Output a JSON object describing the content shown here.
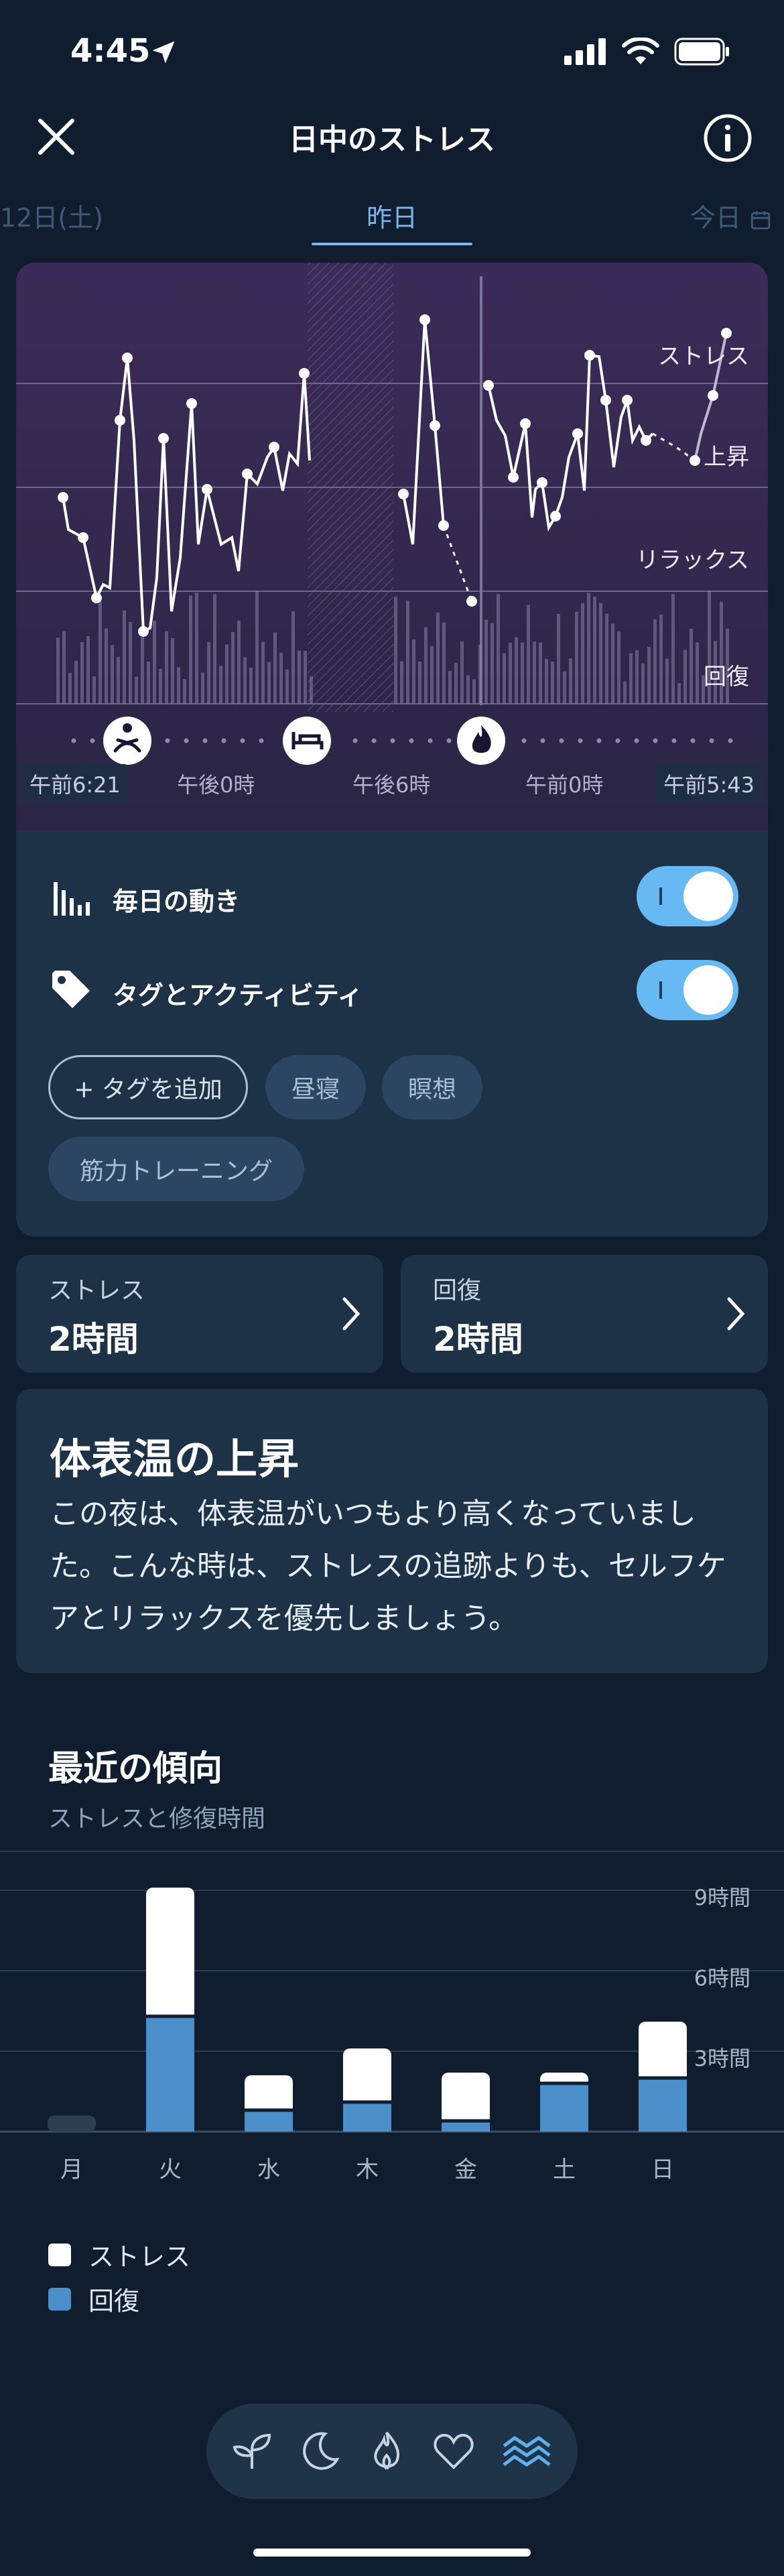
{
  "status": {
    "time": "4:45"
  },
  "header": {
    "title": "日中のストレス"
  },
  "date_tabs": {
    "prev": "12日(土)",
    "current": "昨日",
    "next": "今日"
  },
  "chart": {
    "zone_labels": [
      "ストレス",
      "上昇",
      "リラックス",
      "回復"
    ],
    "time_labels": [
      "午前6:21",
      "午後0時",
      "午後6時",
      "午前0時",
      "午前5:43"
    ],
    "event_icons": [
      "meditation-icon",
      "bed-icon",
      "flame-icon"
    ]
  },
  "controls": {
    "daily_movement_label": "毎日の動き",
    "daily_movement_on": true,
    "tags_label": "タグとアクティビティ",
    "tags_on": true,
    "add_tag_label": "+ タグを追加",
    "tags": [
      "昼寝",
      "瞑想",
      "筋力トレーニング"
    ]
  },
  "summary": [
    {
      "label": "ストレス",
      "value": "2時間"
    },
    {
      "label": "回復",
      "value": "2時間"
    }
  ],
  "insight": {
    "title": "体表温の上昇",
    "body": "この夜は、体表温がいつもより高くなっていました。こんな時は、ストレスの追跡よりも、セルフケアとリラックスを優先しましょう。"
  },
  "trends": {
    "title": "最近の傾向",
    "subtitle": "ストレスと修復時間",
    "legend": [
      {
        "label": "ストレス",
        "color": "#ffffff"
      },
      {
        "label": "回復",
        "color": "#4a8fc9"
      }
    ]
  },
  "chart_data": {
    "type": "bar",
    "categories": [
      "月",
      "火",
      "水",
      "木",
      "金",
      "土",
      "日"
    ],
    "series": [
      {
        "name": "回復",
        "values": [
          0,
          4.3,
          0.8,
          1.1,
          0.4,
          1.8,
          2.0
        ]
      },
      {
        "name": "ストレス",
        "values": [
          0.6,
          4.8,
          1.3,
          2.0,
          1.8,
          0.4,
          2.1
        ]
      }
    ],
    "y_ticks": [
      "3時間",
      "6時間",
      "9時間"
    ],
    "ylim": [
      0,
      9
    ],
    "stacked": true
  },
  "nav": {
    "items": [
      "sprout-icon",
      "moon-icon",
      "flame-icon",
      "heart-icon",
      "waves-icon"
    ],
    "active": "waves-icon"
  }
}
